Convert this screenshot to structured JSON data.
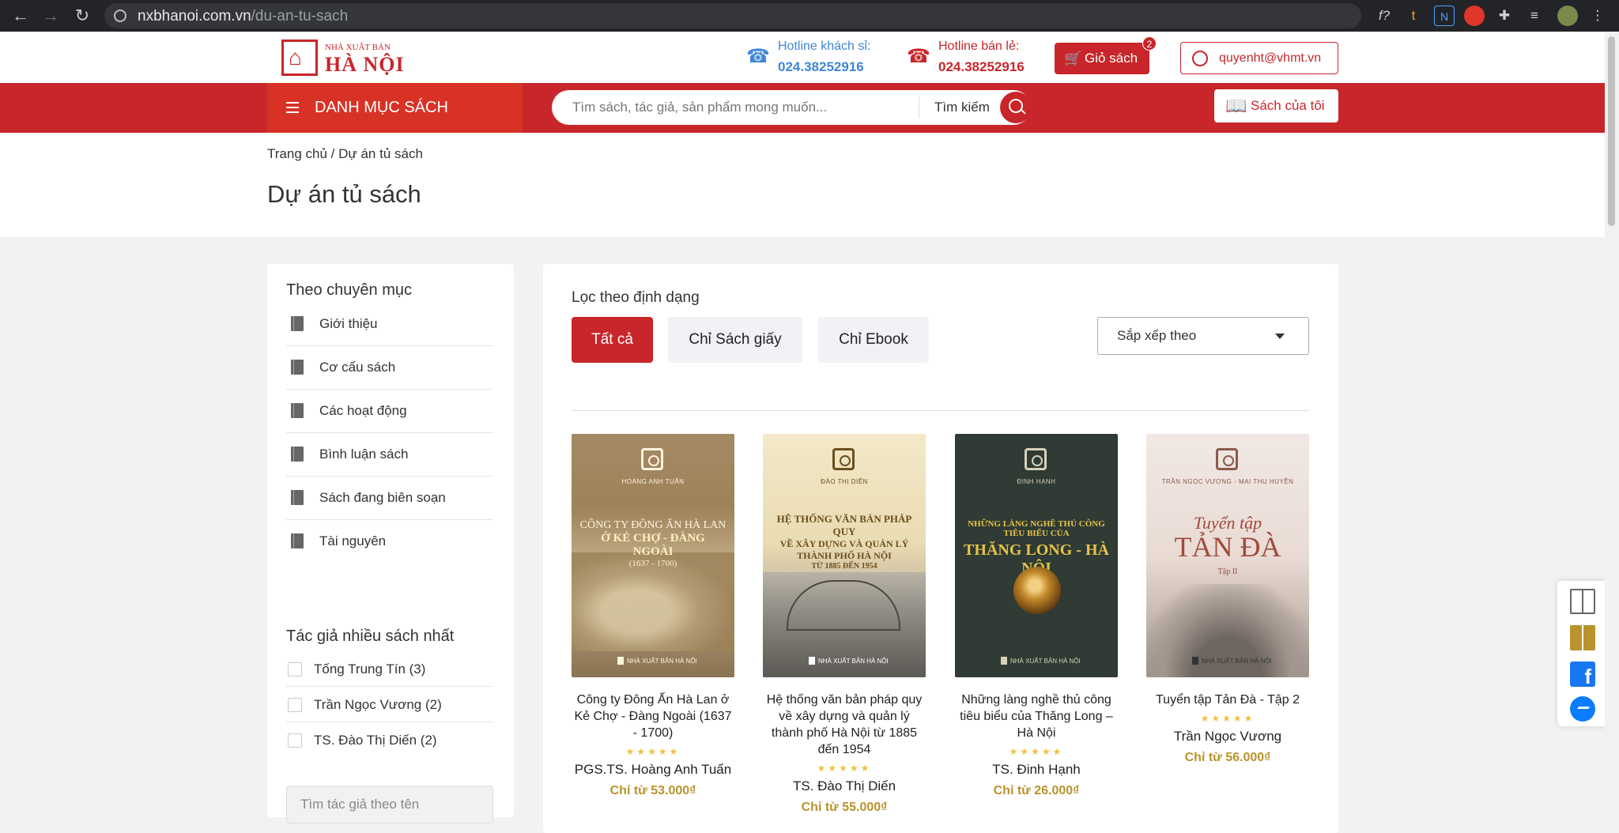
{
  "browser": {
    "url_domain": "nxbhanoi.com.vn",
    "url_path": "/du-an-tu-sach",
    "extensions": [
      "f?",
      "t",
      "N",
      "stop-hand-icon",
      "puzzle-icon",
      "media-icon",
      "profile-avatar"
    ]
  },
  "header": {
    "logo_small": "NHÀ XUẤT BẢN",
    "logo_big": "HÀ NỘI",
    "hotline_customer_label": "Hotline khách sỉ:",
    "hotline_customer_number": "024.38252916",
    "hotline_retail_label": "Hotline bán lẻ:",
    "hotline_retail_number": "024.38252916",
    "cart_label": "Giỏ sách",
    "cart_count": "2",
    "account_email": "quyenht@vhmt.vn"
  },
  "navbar": {
    "categories_label": "DANH MỤC SÁCH",
    "search_placeholder": "Tìm sách, tác giả, sản phẩm mong muốn...",
    "search_button": "Tìm kiếm",
    "my_books": "Sách của tôi"
  },
  "page": {
    "breadcrumb": "Trang chủ / Dự án tủ sách",
    "title": "Dự án tủ sách"
  },
  "sidebar": {
    "category_heading": "Theo chuyên mục",
    "categories": [
      "Giới thiệu",
      "Cơ cấu sách",
      "Các hoạt động",
      "Bình luận sách",
      "Sách đang biên soạn",
      "Tài nguyên"
    ],
    "authors_heading": "Tác giả nhiều sách nhất",
    "authors": [
      "Tống Trung Tín (3)",
      "Trần Ngọc Vương (2)",
      "TS. Đào Thị Diến (2)"
    ],
    "author_search_placeholder": "Tìm tác giả theo tên"
  },
  "filters": {
    "heading": "Lọc theo định dạng",
    "buttons": [
      "Tất cả",
      "Chỉ Sách giấy",
      "Chỉ Ebook"
    ],
    "active": "Tất cả",
    "sort_label": "Sắp xếp theo"
  },
  "books": [
    {
      "title": "Công ty Đông Ấn Hà Lan ở Kẻ Chợ - Đàng Ngoài (1637 - 1700)",
      "author": "PGS.TS. Hoàng Anh Tuấn",
      "price": "Chỉ từ 53.000₫",
      "cover": {
        "author": "HOÀNG ANH TUẤN",
        "line1": "CÔNG TY ĐÔNG ẤN HÀ LAN",
        "line2": "Ở KẺ CHỢ - ĐÀNG NGOÀI",
        "line3": "(1637 - 1700)",
        "publisher": "NHÀ XUẤT BẢN HÀ NỘI"
      }
    },
    {
      "title": "Hệ thống văn bản pháp quy về xây dựng và quản lý thành phố Hà Nội từ 1885 đến 1954",
      "author": "TS. Đào Thị Diến",
      "price": "Chỉ từ 55.000₫",
      "cover": {
        "author": "ĐÀO THỊ DIẾN",
        "line1": "HỆ THỐNG VĂN BẢN PHÁP QUY",
        "line2": "VỀ XÂY DỰNG VÀ QUẢN LÝ",
        "line3": "THÀNH PHỐ HÀ NỘI",
        "line4": "TỪ 1885 ĐẾN 1954",
        "publisher": "NHÀ XUẤT BẢN HÀ NỘI"
      }
    },
    {
      "title": "Những làng nghề thủ công tiêu biểu của Thăng Long – Hà Nội",
      "author": "TS. Đinh Hạnh",
      "price": "Chỉ từ 26.000₫",
      "cover": {
        "author": "ĐINH HẠNH",
        "line1": "NHỮNG LÀNG NGHỀ THỦ CÔNG TIÊU BIỂU CỦA",
        "line2": "THĂNG LONG - HÀ NỘI",
        "publisher": "NHÀ XUẤT BẢN HÀ NỘI"
      }
    },
    {
      "title": "Tuyển tập Tản Đà - Tập 2",
      "author": "Trần Ngọc Vương",
      "price": "Chỉ từ 56.000₫",
      "cover": {
        "author": "TRẦN NGỌC VƯƠNG - MAI THU HUYỀN",
        "line1": "Tuyển tập",
        "line2": "TẢN ĐÀ",
        "line3": "Tập II",
        "publisher": "NHÀ XUẤT BẢN HÀ NỘI"
      }
    }
  ],
  "stars": "★★★★★",
  "colors": {
    "brand_red": "#c8262a",
    "price_gold": "#b8932b",
    "hotline_blue": "#3f86d6"
  }
}
